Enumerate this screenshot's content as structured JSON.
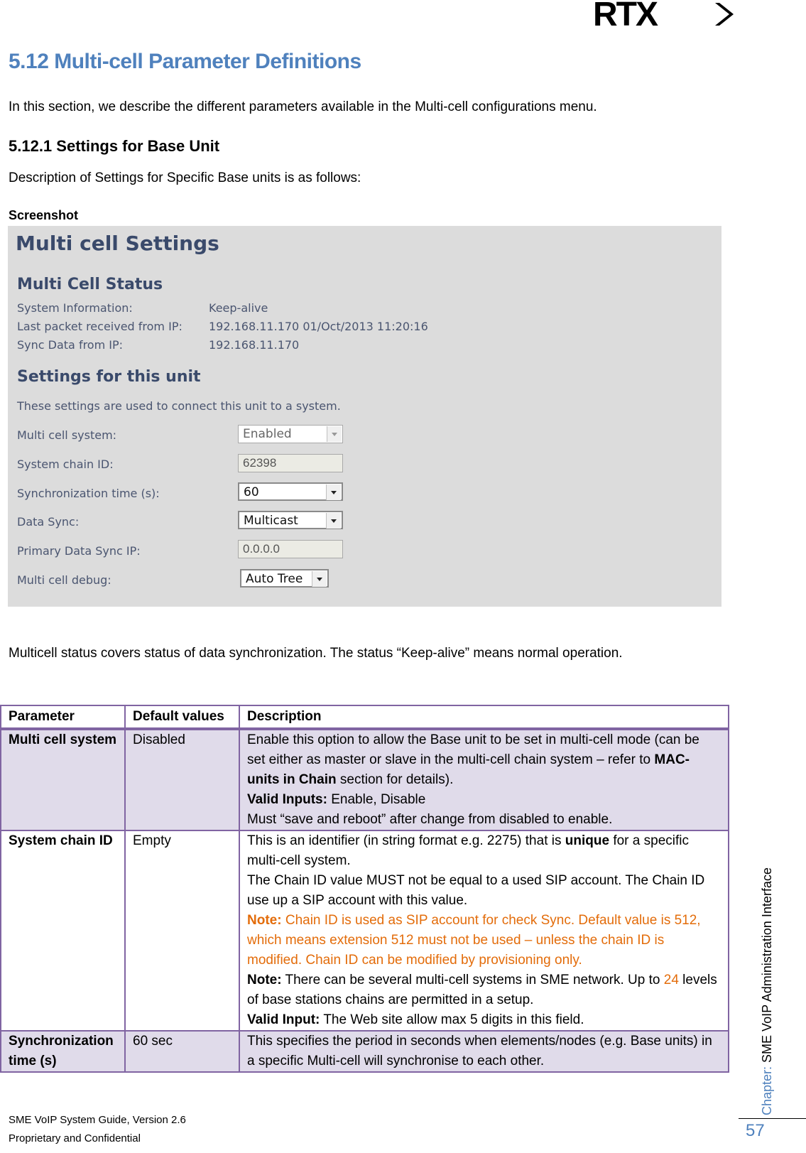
{
  "logo": {
    "text": "RTX"
  },
  "section_title": "5.12 Multi-cell Parameter Definitions",
  "intro": "In this section, we describe the different parameters available in the Multi-cell configurations menu.",
  "subsection_title": "5.12.1 Settings for Base Unit",
  "subsection_desc": "Description of Settings for Specific Base units is as follows:",
  "screenshot_label": "Screenshot",
  "screenshot": {
    "title": "Multi cell Settings",
    "status_heading": "Multi Cell Status",
    "status": [
      {
        "label": "System Information:",
        "value": "Keep-alive"
      },
      {
        "label": "Last packet received from IP:",
        "value": "192.168.11.170 01/Oct/2013 11:20:16"
      },
      {
        "label": "Sync Data from IP:",
        "value": "192.168.11.170"
      }
    ],
    "settings_heading": "Settings for this unit",
    "settings_desc": "These settings are used to connect this unit to a system.",
    "fields": {
      "multi_cell_system": {
        "label": "Multi cell system:",
        "value": "Enabled"
      },
      "system_chain_id": {
        "label": "System chain ID:",
        "value": "62398"
      },
      "sync_time": {
        "label": "Synchronization time (s):",
        "value": "60"
      },
      "data_sync": {
        "label": "Data Sync:",
        "value": "Multicast"
      },
      "primary_data_sync_ip": {
        "label": "Primary Data Sync IP:",
        "value": "0.0.0.0"
      },
      "multi_cell_debug": {
        "label": "Multi cell debug:",
        "value": "Auto Tree"
      }
    }
  },
  "status_paragraph": "Multicell status covers status of data synchronization. The status “Keep-alive” means normal operation.",
  "table": {
    "headers": [
      "Parameter",
      "Default values",
      "Description"
    ],
    "rows": [
      {
        "parameter": "Multi cell system",
        "default": "Disabled",
        "desc": {
          "l1": "Enable this option to allow the Base unit to be set in multi-cell mode (can be set either as master or slave in the multi-cell chain system – refer to ",
          "l1_bold": "MAC-units in Chain",
          "l1_end": " section for details).",
          "valid_label": "Valid Inputs:",
          "valid_value": " Enable, Disable",
          "l3": "Must “save and reboot” after change from disabled to enable."
        }
      },
      {
        "parameter": "System chain ID",
        "default": "Empty",
        "desc": {
          "l1": "This is an identifier (in string format e.g. 2275) that is ",
          "l1_bold": "unique",
          "l1_end": " for a specific multi-cell system.",
          "l2": "The Chain ID value MUST not be equal to a used SIP account. The Chain ID use up a SIP account with this value.",
          "note1_label": "Note:",
          "note1_text": " Chain ID is used as SIP account for check Sync. Default value is 512, which means extension 512 must not be used – unless the chain ID is modified. Chain ID can be modified by provisioning only.",
          "note2_label": "Note:",
          "note2_text": " There can be several multi-cell systems in SME network. Up to ",
          "note2_num": "24",
          "note2_end": " levels of base stations chains are permitted in a setup.",
          "valid_label": "Valid Input:",
          "valid_value": " The Web site allow max 5 digits in this field."
        }
      },
      {
        "parameter": "Synchronization time (s)",
        "default": "60 sec",
        "desc": {
          "l1": "This specifies the period in seconds when elements/nodes (e.g. Base units) in a specific Multi-cell will synchronise to each other."
        }
      }
    ]
  },
  "side": {
    "lead": "Chapter: ",
    "text": "SME VoIP Administration Interface"
  },
  "page_number": "57",
  "footer": {
    "line1": "SME VoIP System Guide, Version 2.6",
    "line2": "Proprietary and Confidential"
  }
}
